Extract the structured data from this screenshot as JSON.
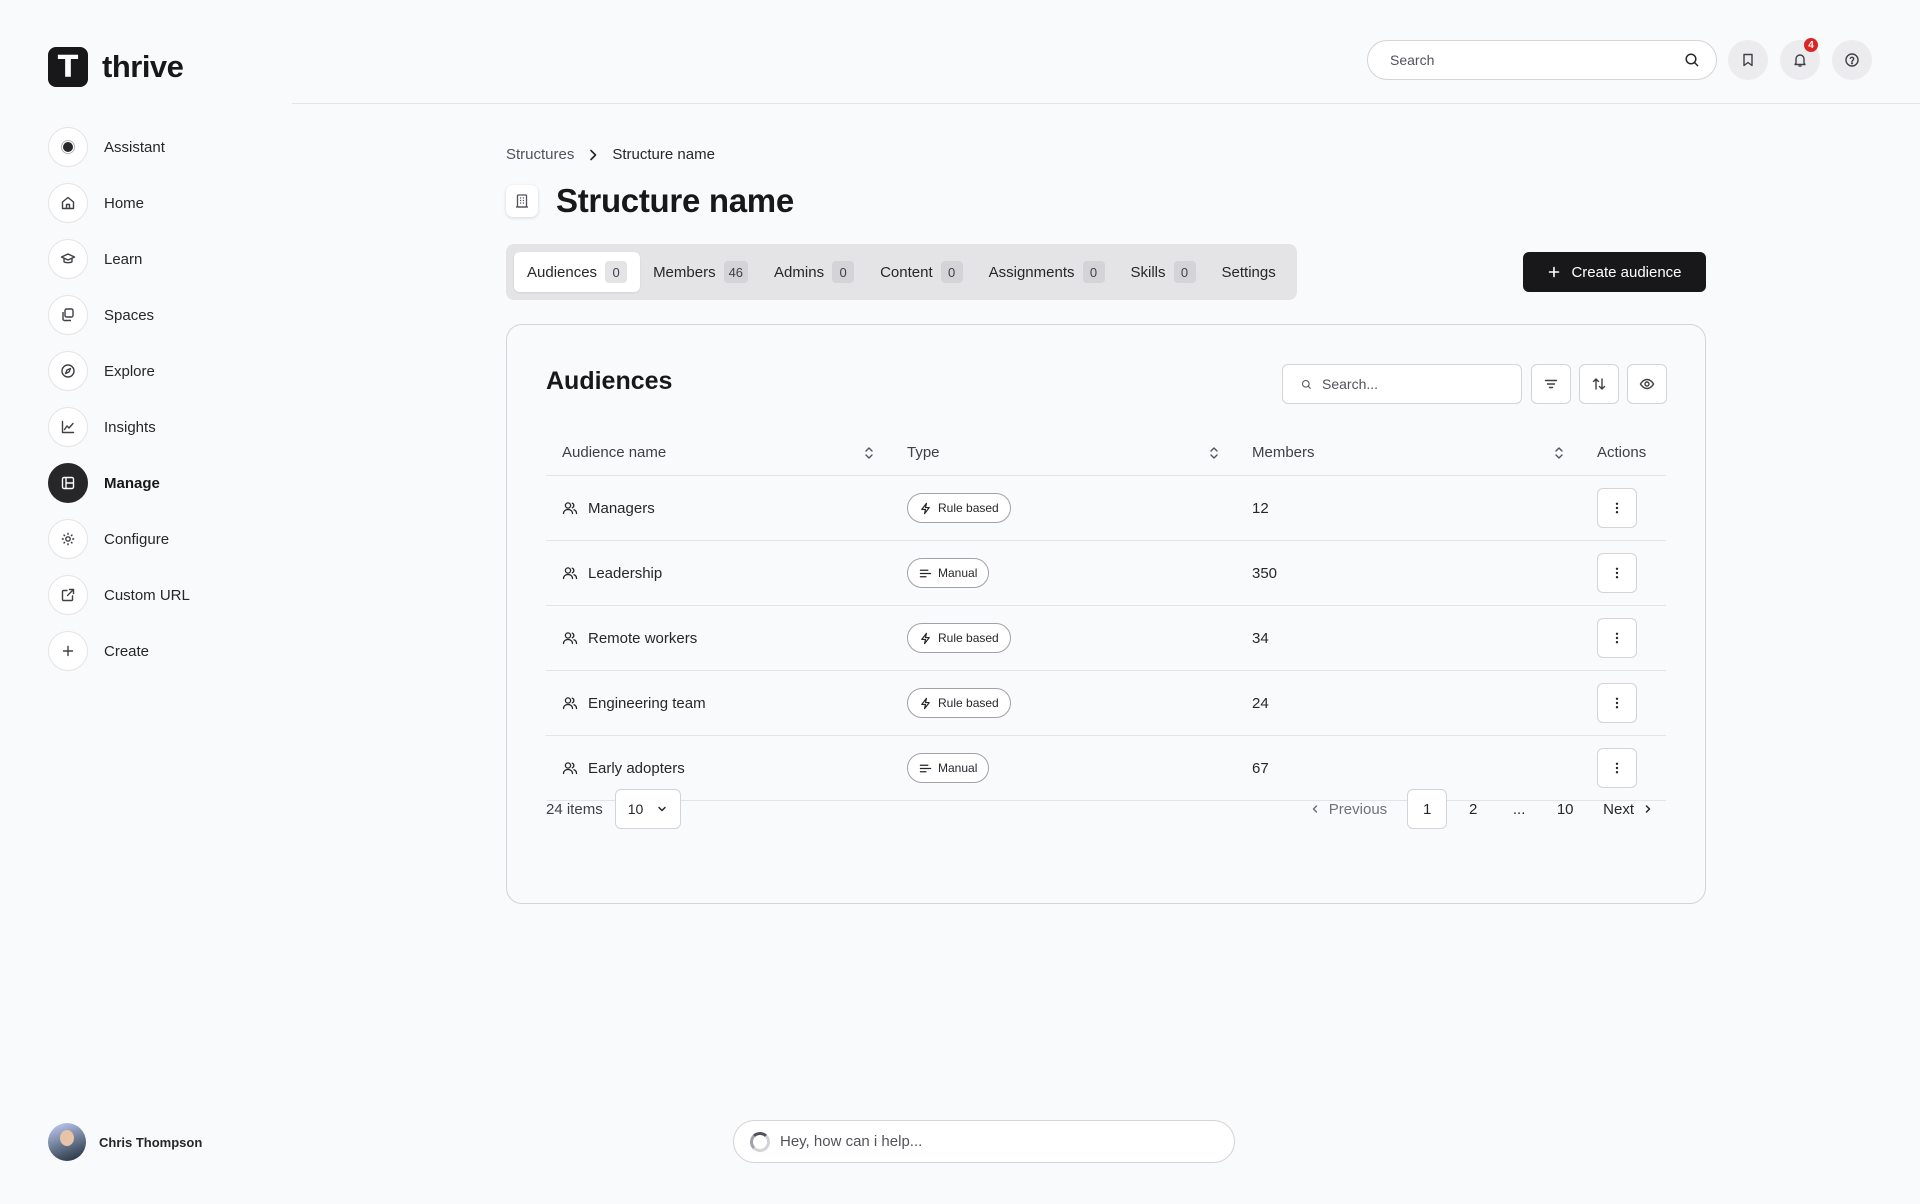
{
  "brand": {
    "logo_letter": "T",
    "name": "thrive"
  },
  "sidebar": {
    "items": [
      {
        "label": "Assistant",
        "icon": "assistant-orb-icon"
      },
      {
        "label": "Home",
        "icon": "home-icon"
      },
      {
        "label": "Learn",
        "icon": "graduation-cap-icon"
      },
      {
        "label": "Spaces",
        "icon": "spaces-icon"
      },
      {
        "label": "Explore",
        "icon": "compass-icon"
      },
      {
        "label": "Insights",
        "icon": "chart-line-icon"
      },
      {
        "label": "Manage",
        "icon": "manage-icon",
        "active": true
      },
      {
        "label": "Configure",
        "icon": "gear-icon"
      },
      {
        "label": "Custom URL",
        "icon": "external-link-icon"
      },
      {
        "label": "Create",
        "icon": "plus-icon"
      }
    ],
    "user": {
      "name": "Chris Thompson"
    }
  },
  "topbar": {
    "search_placeholder": "Search",
    "notification_count": "4"
  },
  "breadcrumb": {
    "parent": "Structures",
    "current": "Structure name"
  },
  "page": {
    "title": "Structure name"
  },
  "tabs": [
    {
      "label": "Audiences",
      "count": "0",
      "active": true
    },
    {
      "label": "Members",
      "count": "46"
    },
    {
      "label": "Admins",
      "count": "0"
    },
    {
      "label": "Content",
      "count": "0"
    },
    {
      "label": "Assignments",
      "count": "0"
    },
    {
      "label": "Skills",
      "count": "0"
    },
    {
      "label": "Settings"
    }
  ],
  "create_button": {
    "label": "Create audience"
  },
  "audiences": {
    "title": "Audiences",
    "search_placeholder": "Search...",
    "columns": {
      "name": "Audience name",
      "type": "Type",
      "members": "Members",
      "actions": "Actions"
    },
    "rows": [
      {
        "name": "Managers",
        "type": "Rule based",
        "members": "12"
      },
      {
        "name": "Leadership",
        "type": "Manual",
        "members": "350"
      },
      {
        "name": "Remote workers",
        "type": "Rule based",
        "members": "34"
      },
      {
        "name": "Engineering team",
        "type": "Rule based",
        "members": "24"
      },
      {
        "name": "Early adopters",
        "type": "Manual",
        "members": "67"
      }
    ],
    "footer": {
      "items_count": "24 items",
      "page_size": "10",
      "pagination": {
        "previous": "Previous",
        "pages": [
          "1",
          "2",
          "...",
          "10"
        ],
        "current": "1",
        "next": "Next"
      }
    }
  },
  "assistant_bar": {
    "placeholder": "Hey, how can i help..."
  },
  "colors": {
    "primary": "#18181b",
    "background": "#f9fafb",
    "border": "#d4d4d8",
    "badge": "#dc2626"
  }
}
